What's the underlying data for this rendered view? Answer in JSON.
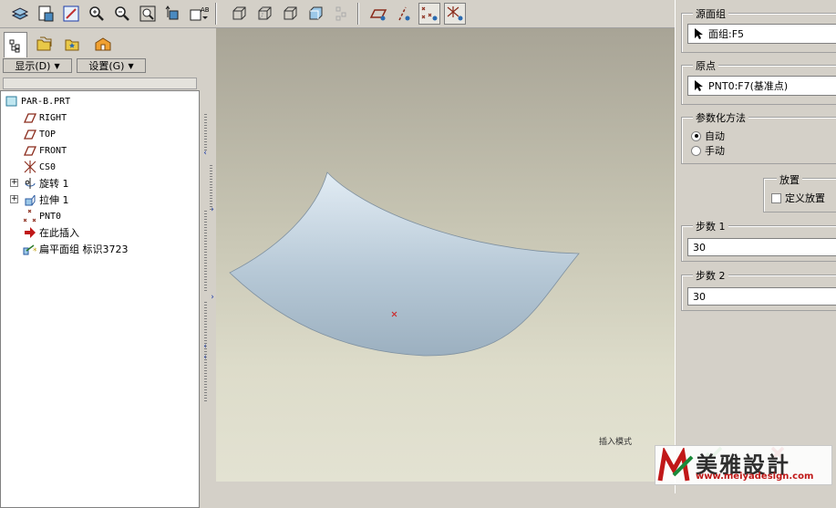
{
  "left_panel": {
    "menu_display": "显示(D)",
    "menu_settings": "设置(G)",
    "tree": [
      {
        "label": "PAR-B.PRT",
        "icon": "part-icon"
      },
      {
        "label": "RIGHT",
        "icon": "datum-plane-icon"
      },
      {
        "label": "TOP",
        "icon": "datum-plane-icon"
      },
      {
        "label": "FRONT",
        "icon": "datum-plane-icon"
      },
      {
        "label": "CS0",
        "icon": "coordinate-system-icon"
      },
      {
        "label": "旋转 1",
        "icon": "revolve-icon"
      },
      {
        "label": "拉伸 1",
        "icon": "extrude-icon"
      },
      {
        "label": "PNT0",
        "icon": "datum-point-icon"
      },
      {
        "label": "在此插入",
        "icon": "insert-here-arrow-icon"
      },
      {
        "label": "扁平面组 标识3723",
        "icon": "flatten-quilt-icon"
      }
    ]
  },
  "viewport": {
    "status": "插入模式"
  },
  "dialog": {
    "source_group_title": "源面组",
    "source_group_value": "面组:F5",
    "origin_title": "原点",
    "origin_value": "PNT0:F7(基准点)",
    "param_method_title": "参数化方法",
    "param_auto": "自动",
    "param_manual": "手动",
    "placement_title": "放置",
    "define_placement": "定义放置",
    "step1_title": "步数 1",
    "step1_value": "30",
    "step2_title": "步数 2",
    "step2_value": "30"
  },
  "watermark": {
    "name": "美雅設計",
    "url": "www.meiyadesign.com"
  },
  "colors": {
    "ok": "#2a8a2a",
    "cancel": "#b01818",
    "accent": "#1a3aa8"
  }
}
